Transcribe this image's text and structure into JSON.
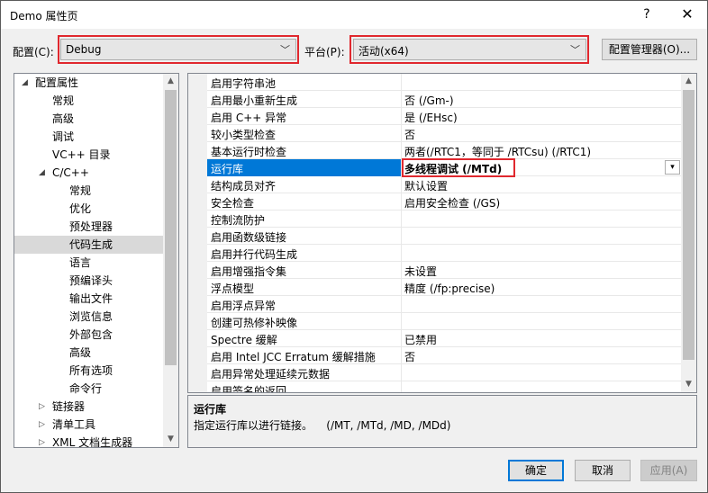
{
  "window": {
    "title": "Demo 属性页",
    "help_glyph": "?",
    "close_glyph": "✕"
  },
  "config": {
    "config_label": "配置(C):",
    "config_value": "Debug",
    "platform_label": "平台(P):",
    "platform_value": "活动(x64)",
    "manager_button": "配置管理器(O)...",
    "highlight_color": "#e0282e"
  },
  "tree": {
    "items": [
      {
        "label": "配置属性",
        "expander": "◢"
      },
      {
        "label": "常规"
      },
      {
        "label": "高级"
      },
      {
        "label": "调试"
      },
      {
        "label": "VC++ 目录"
      },
      {
        "label": "C/C++",
        "expander": "◢"
      },
      {
        "label": "常规"
      },
      {
        "label": "优化"
      },
      {
        "label": "预处理器"
      },
      {
        "label": "代码生成",
        "selected": true
      },
      {
        "label": "语言"
      },
      {
        "label": "预编译头"
      },
      {
        "label": "输出文件"
      },
      {
        "label": "浏览信息"
      },
      {
        "label": "外部包含"
      },
      {
        "label": "高级"
      },
      {
        "label": "所有选项"
      },
      {
        "label": "命令行"
      },
      {
        "label": "链接器",
        "expander": "▷"
      },
      {
        "label": "清单工具",
        "expander": "▷"
      },
      {
        "label": "XML 文档生成器",
        "expander": "▷"
      }
    ]
  },
  "grid": {
    "rows": [
      {
        "name": "启用字符串池",
        "value": ""
      },
      {
        "name": "启用最小重新生成",
        "value": "否 (/Gm-)"
      },
      {
        "name": "启用 C++ 异常",
        "value": "是 (/EHsc)"
      },
      {
        "name": "较小类型检查",
        "value": "否"
      },
      {
        "name": "基本运行时检查",
        "value": "两者(/RTC1，等同于 /RTCsu) (/RTC1)"
      },
      {
        "name": "运行库",
        "value": "多线程调试 (/MTd)",
        "selected": true
      },
      {
        "name": "结构成员对齐",
        "value": "默认设置"
      },
      {
        "name": "安全检查",
        "value": "启用安全检查 (/GS)"
      },
      {
        "name": "控制流防护",
        "value": ""
      },
      {
        "name": "启用函数级链接",
        "value": ""
      },
      {
        "name": "启用并行代码生成",
        "value": ""
      },
      {
        "name": "启用增强指令集",
        "value": "未设置"
      },
      {
        "name": "浮点模型",
        "value": "精度 (/fp:precise)"
      },
      {
        "name": "启用浮点异常",
        "value": ""
      },
      {
        "name": "创建可热修补映像",
        "value": ""
      },
      {
        "name": "Spectre 缓解",
        "value": "已禁用"
      },
      {
        "name": "启用 Intel JCC Erratum 缓解措施",
        "value": "否"
      },
      {
        "name": "启用异常处理延续元数据",
        "value": ""
      },
      {
        "name": "启用签名的返回",
        "value": ""
      }
    ]
  },
  "description": {
    "title": "运行库",
    "text": "指定运行库以进行链接。    (/MT, /MTd, /MD, /MDd)"
  },
  "buttons": {
    "ok": "确定",
    "cancel": "取消",
    "apply": "应用(A)"
  }
}
